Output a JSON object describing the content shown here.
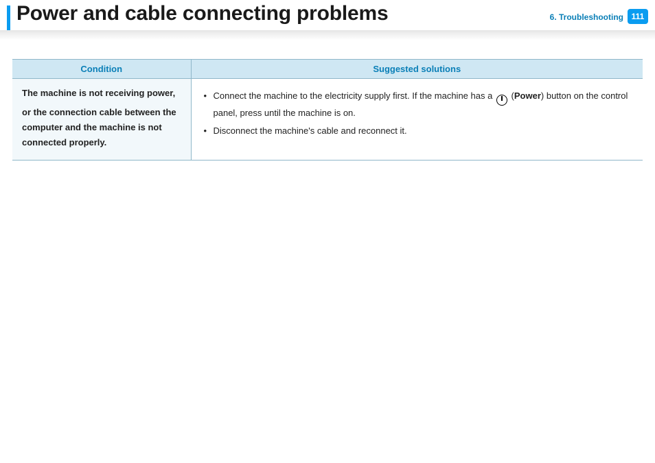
{
  "header": {
    "title": "Power and cable connecting problems",
    "breadcrumb": "6.  Troubleshooting",
    "page_number": "111"
  },
  "table": {
    "headers": {
      "condition": "Condition",
      "solutions": "Suggested solutions"
    },
    "row": {
      "condition_line1": "The machine is not receiving power,",
      "condition_rest": "or the connection cable between the computer and the machine is not connected properly.",
      "sol1_pre": "Connect the machine to the electricity supply first. If the machine has a ",
      "sol1_power_label": "Power",
      "sol1_post": ") button on the control panel, press until the machine is on.",
      "sol2": "Disconnect the machine's cable and reconnect it."
    }
  }
}
